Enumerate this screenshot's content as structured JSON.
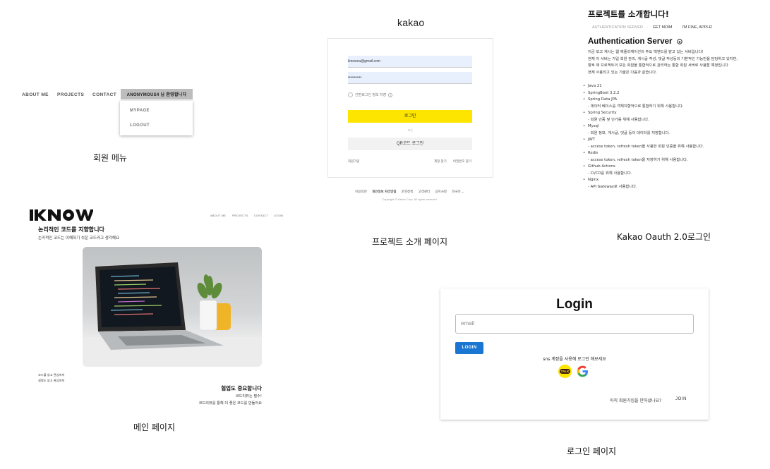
{
  "member_menu": {
    "nav": [
      "ABOUT ME",
      "PROJECTS",
      "CONTACT"
    ],
    "user_badge": "ANONYMOUS4 님 환영합니다",
    "dropdown": [
      "MYPAGE",
      "LOGOUT"
    ],
    "caption": "회원 메뉴"
  },
  "kakao": {
    "logo": "kakao",
    "email_value": "iknowca@gmail.com",
    "password_value": "•••••••••••",
    "remember_label": "간편로그인 정보 저장",
    "login_button": "로그인",
    "or_text": "또는",
    "qr_button": "QR코드 로그인",
    "signup_link": "회원가입",
    "find_account": "계정 찾기",
    "find_password": "비밀번호 찾기",
    "footer_links": [
      "이용약관",
      "개인정보 처리방침",
      "운영정책",
      "고객센터",
      "공지사항",
      "한국어 ⌄"
    ],
    "copyright": "Copyright © Kakao Corp. All rights reserved.",
    "caption": "Kakao Oauth 2.0로그인"
  },
  "project": {
    "title": "프로젝트를 소개합니다!",
    "tabs": [
      "AUTHENTICATION SERVER",
      "·",
      "GET MOIM",
      "·",
      "I'M FINE, APPLE!"
    ],
    "auth_title": "Authentication Server",
    "desc": [
      "지금 보고 계시는 웹 애플리케이션의 주요 백엔드를 맡고 있는 서버입니다!",
      "현재 이 서버는 가입 회원 관리, 게시글 작성, 댓글 작성등의 기본적인 기능만을 담당하고 있지만,",
      "향후 제 프로젝트의 모든 회원을 통합적으로 관리하는 통합 회원 서버로 사용할 예정입니다",
      "현재 사용되고 있는 기술은 다음과 같습니다."
    ],
    "tech": [
      {
        "name": "Java 21",
        "sub": ""
      },
      {
        "name": "SpringBoot 3.2.2",
        "sub": ""
      },
      {
        "name": "Spring Data JPA",
        "sub": "- 데이터 베이스를 객체지향적으로 통합하기 위해 사용합니다."
      },
      {
        "name": "Spring Security",
        "sub": "- 회원 인증 및 인가를 위해 사용합니다."
      },
      {
        "name": "Mysql",
        "sub": "- 회원 정보, 게시글, 댓글 등의 데이터를 저장합니다."
      },
      {
        "name": "JWT",
        "sub": "- access token, refresh token을 사용한 회원 인증을 위해 사용합니다."
      },
      {
        "name": "Redis",
        "sub": "- access token, refresh token을 저장하기 위해 사용합니다."
      },
      {
        "name": "Github Actions",
        "sub": "- CI/CD를 위해 사용합니다."
      },
      {
        "name": "Nginx",
        "sub": "- API Gateway로 사용합니다."
      }
    ],
    "caption": "프로젝트 소개 페이지"
  },
  "main_page": {
    "logo": "IKNOW",
    "nav": [
      "ABOUT ME",
      "PROJECTS",
      "CONTACT",
      "LOGIN"
    ],
    "headline": "논리적인 코드를 지향합니다",
    "subline": "논리적인 코드는 이해하기 쉬운 코드라고 생각해요",
    "small1": "코드를 읽고 관심꺼져",
    "small2": "설명도 읽고 관심꺼져",
    "collab_title": "협업도 중요합니다",
    "collab_sub1": "코드리뷰는 필수!",
    "collab_sub2": "코드리뷰를 통해 더 좋은 코드를 만들어요",
    "caption": "메인 페이지"
  },
  "login_page": {
    "title": "Login",
    "email_placeholder": "email",
    "login_button": "LOGIN",
    "sns_text": "sns 계정을 사용해 로그인 해보세요",
    "kakao_icon_label": "TALK",
    "join_question": "아직 회원가입을 안하셨나요?",
    "join_button": "JOIN",
    "caption": "로그인 페이지"
  }
}
